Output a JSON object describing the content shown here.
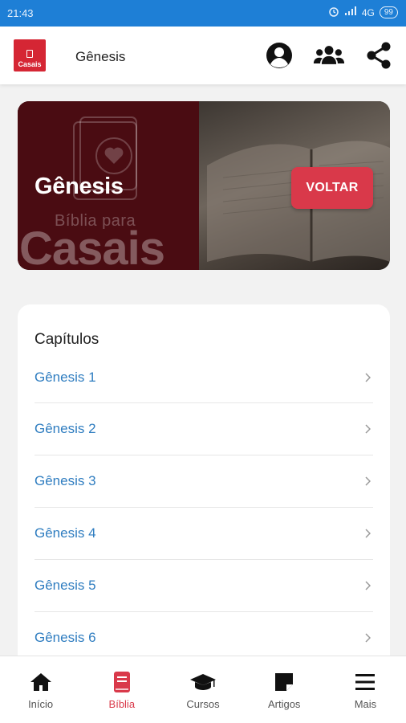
{
  "status_bar": {
    "time": "21:43",
    "network": "4G",
    "battery": "99"
  },
  "app_bar": {
    "title": "Gênesis",
    "logo_text": "Casais"
  },
  "hero": {
    "title": "Gênesis",
    "brand_top": "Bíblia para",
    "brand_bottom": "Casais",
    "back_label": "VOLTAR"
  },
  "chapters": {
    "heading": "Capítulos",
    "items": [
      {
        "label": "Gênesis 1"
      },
      {
        "label": "Gênesis 2"
      },
      {
        "label": "Gênesis 3"
      },
      {
        "label": "Gênesis 4"
      },
      {
        "label": "Gênesis 5"
      },
      {
        "label": "Gênesis 6"
      }
    ]
  },
  "bottom_nav": {
    "items": [
      {
        "label": "Início",
        "icon": "home-icon"
      },
      {
        "label": "Bíblia",
        "icon": "bible-icon",
        "active": true
      },
      {
        "label": "Cursos",
        "icon": "graduation-cap-icon"
      },
      {
        "label": "Artigos",
        "icon": "sticky-note-icon"
      },
      {
        "label": "Mais",
        "icon": "menu-icon"
      }
    ]
  },
  "colors": {
    "status_bar": "#1e7fd6",
    "accent": "#d9394a",
    "link": "#2f7dc0",
    "hero_left": "#4a0c12"
  }
}
